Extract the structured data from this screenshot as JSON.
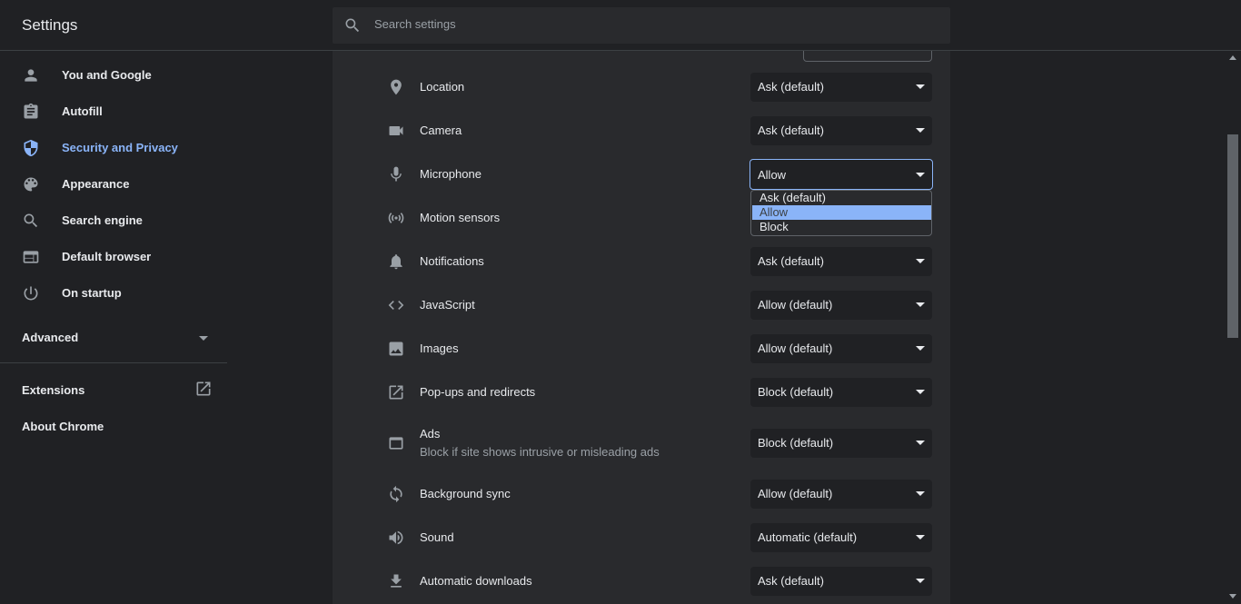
{
  "header": {
    "title": "Settings",
    "search_placeholder": "Search settings"
  },
  "sidebar": {
    "items": [
      {
        "label": "You and Google",
        "icon": "person-icon"
      },
      {
        "label": "Autofill",
        "icon": "clipboard-icon"
      },
      {
        "label": "Security and Privacy",
        "icon": "shield-icon"
      },
      {
        "label": "Appearance",
        "icon": "palette-icon"
      },
      {
        "label": "Search engine",
        "icon": "search-icon"
      },
      {
        "label": "Default browser",
        "icon": "browser-icon"
      },
      {
        "label": "On startup",
        "icon": "power-icon"
      }
    ],
    "advanced_label": "Advanced",
    "extensions_label": "Extensions",
    "about_label": "About Chrome"
  },
  "permissions": [
    {
      "label": "Location",
      "value": "Ask (default)",
      "icon": "location-pin-icon"
    },
    {
      "label": "Camera",
      "value": "Ask (default)",
      "icon": "camera-icon"
    },
    {
      "label": "Microphone",
      "value": "Allow",
      "icon": "microphone-icon"
    },
    {
      "label": "Motion sensors",
      "value": "",
      "icon": "motion-sensor-icon"
    },
    {
      "label": "Notifications",
      "value": "Ask (default)",
      "icon": "bell-icon"
    },
    {
      "label": "JavaScript",
      "value": "Allow (default)",
      "icon": "code-icon"
    },
    {
      "label": "Images",
      "value": "Allow (default)",
      "icon": "image-icon"
    },
    {
      "label": "Pop-ups and redirects",
      "value": "Block (default)",
      "icon": "open-external-icon"
    },
    {
      "label": "Ads",
      "sublabel": "Block if site shows intrusive or misleading ads",
      "value": "Block (default)",
      "icon": "ads-window-icon"
    },
    {
      "label": "Background sync",
      "value": "Allow (default)",
      "icon": "sync-icon"
    },
    {
      "label": "Sound",
      "value": "Automatic (default)",
      "icon": "speaker-icon"
    },
    {
      "label": "Automatic downloads",
      "value": "Ask (default)",
      "icon": "download-icon"
    }
  ],
  "dropdown": {
    "options": [
      "Ask (default)",
      "Allow",
      "Block"
    ],
    "selected": "Allow"
  },
  "colors": {
    "background": "#202124",
    "card": "#292a2d",
    "accent": "#8ab4f8",
    "text": "#e8eaed",
    "secondary_text": "#9aa0a6"
  }
}
